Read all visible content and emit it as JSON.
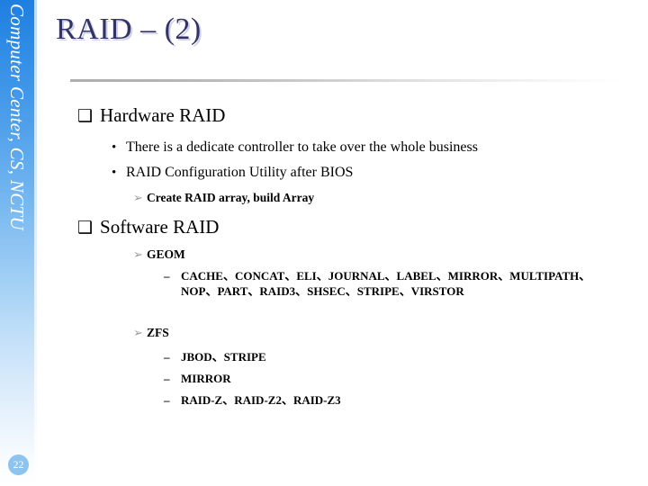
{
  "slide": {
    "title": "RAID – (2)",
    "page_number": "22",
    "sidebar_label": "Computer Center, CS, NCTU",
    "title_color": "#333366",
    "sidebar_gradient_top": "#1f7fe0",
    "sidebar_gradient_bottom": "#ffffff",
    "badge_color": "#8cc3ef",
    "arrow_bullet_color": "#9a9a9a"
  },
  "bullets": {
    "square_glyph": "❑",
    "dot_glyph": "•",
    "arrow_glyph": "➢",
    "dash_glyph": "–"
  },
  "sections": [
    {
      "heading": "Hardware RAID",
      "items": [
        "There is a dedicate controller to take over the whole business",
        "RAID Configuration Utility after BIOS"
      ],
      "subitem": "Create RAID array, build Array"
    },
    {
      "heading": "Software RAID",
      "groups": [
        {
          "name": "GEOM",
          "entries": "CACHE、CONCAT、ELI、JOURNAL、LABEL、MIRROR、MULTIPATH、NOP、PART、RAID3、SHSEC、STRIPE、VIRSTOR"
        },
        {
          "name": "ZFS",
          "lines": [
            "JBOD、STRIPE",
            "MIRROR",
            "RAID-Z、RAID-Z2、RAID-Z3"
          ]
        }
      ]
    }
  ]
}
